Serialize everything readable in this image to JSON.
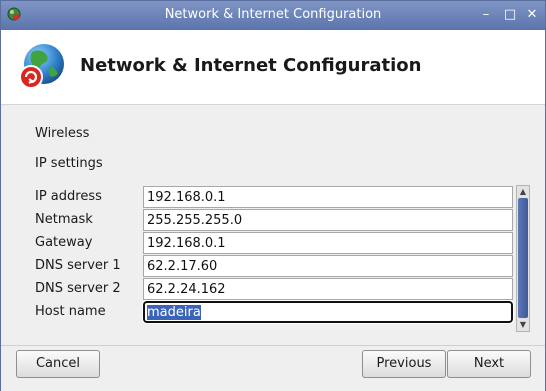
{
  "window": {
    "title": "Network & Internet Configuration",
    "minimize_glyph": "–",
    "maximize_glyph": "□",
    "close_glyph": "✕"
  },
  "header": {
    "heading": "Network & Internet Configuration",
    "icon": "globe-network-icon"
  },
  "sections": {
    "wireless": "Wireless",
    "ip_settings": "IP settings"
  },
  "fields": [
    {
      "label": "IP address",
      "value": "192.168.0.1"
    },
    {
      "label": "Netmask",
      "value": "255.255.255.0"
    },
    {
      "label": "Gateway",
      "value": "192.168.0.1"
    },
    {
      "label": "DNS server 1",
      "value": "62.2.17.60"
    },
    {
      "label": "DNS server 2",
      "value": "62.2.24.162"
    },
    {
      "label": "Host name",
      "value": "madeira",
      "focused": true
    }
  ],
  "buttons": {
    "cancel": "Cancel",
    "previous": "Previous",
    "next": "Next"
  },
  "colors": {
    "titlebar": "#6d85b9",
    "selection": "#3b63b8",
    "scroll_thumb": "#4a66a6"
  }
}
